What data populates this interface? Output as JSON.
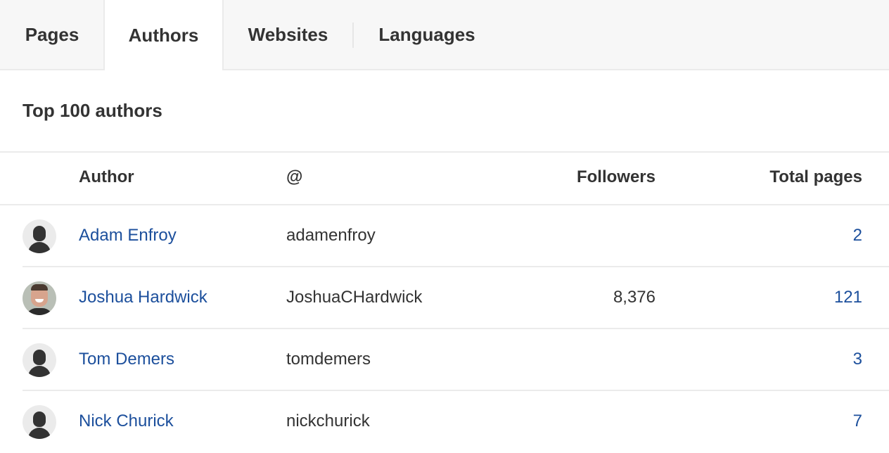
{
  "tabs": [
    {
      "label": "Pages",
      "active": false
    },
    {
      "label": "Authors",
      "active": true
    },
    {
      "label": "Websites",
      "active": false
    },
    {
      "label": "Languages",
      "active": false
    }
  ],
  "section": {
    "title": "Top 100 authors"
  },
  "table": {
    "columns": {
      "author": "Author",
      "handle": "@",
      "followers": "Followers",
      "total_pages": "Total pages"
    },
    "rows": [
      {
        "avatar": "default-avatar-icon",
        "name": "Adam Enfroy",
        "handle": "adamenfroy",
        "followers": "",
        "total_pages": "2"
      },
      {
        "avatar": "profile-photo",
        "name": "Joshua Hardwick",
        "handle": "JoshuaCHardwick",
        "followers": "8,376",
        "total_pages": "121"
      },
      {
        "avatar": "default-avatar-icon",
        "name": "Tom Demers",
        "handle": "tomdemers",
        "followers": "",
        "total_pages": "3"
      },
      {
        "avatar": "default-avatar-icon",
        "name": "Nick Churick",
        "handle": "nickchurick",
        "followers": "",
        "total_pages": "7"
      }
    ]
  },
  "colors": {
    "link": "#1c4f9c",
    "text": "#333333",
    "tab_bar_bg": "#f7f7f7",
    "border": "#ebebeb"
  }
}
